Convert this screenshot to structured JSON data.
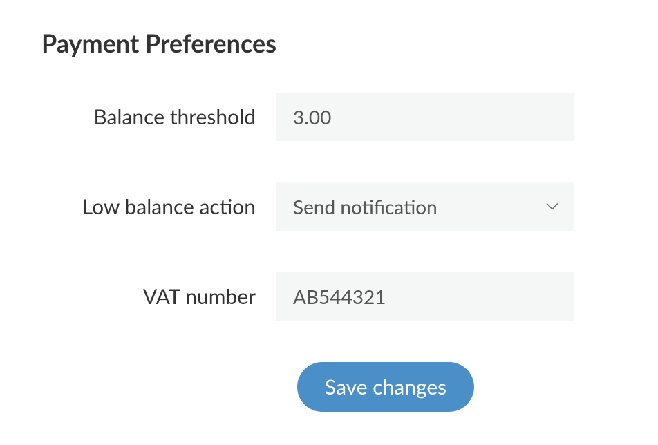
{
  "title": "Payment Preferences",
  "fields": {
    "balance_threshold": {
      "label": "Balance threshold",
      "value": "3.00"
    },
    "low_balance_action": {
      "label": "Low balance action",
      "value": "Send notification"
    },
    "vat_number": {
      "label": "VAT number",
      "value": "AB544321"
    }
  },
  "buttons": {
    "save": "Save changes"
  }
}
